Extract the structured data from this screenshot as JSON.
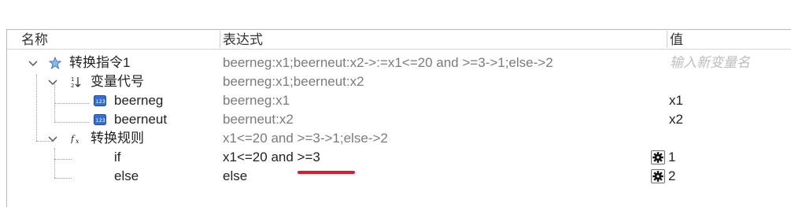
{
  "columns": {
    "name": "名称",
    "expression": "表达式",
    "value": "值"
  },
  "rows": {
    "root": {
      "name": "转换指令1",
      "expr": "beerneg:x1;beerneut:x2->:=x1<=20 and >=3->1;else->2",
      "value_placeholder": "输入新变量名",
      "icon": "star-icon"
    },
    "vars": {
      "name": "变量代号",
      "expr": "beerneg:x1;beerneut:x2",
      "icon": "number-sort-icon"
    },
    "beerneg": {
      "name": "beerneg",
      "expr": "beerneg:x1",
      "value": "x1",
      "icon": "variable-123-icon"
    },
    "beerneut": {
      "name": "beerneut",
      "expr": "beerneut:x2",
      "value": "x2",
      "icon": "variable-123-icon"
    },
    "rules": {
      "name": "转换规则",
      "expr": "x1<=20 and >=3->1;else->2",
      "icon": "function-fx-icon"
    },
    "if": {
      "name": "if",
      "expr": "x1<=20 and >=3",
      "value": "1",
      "icon": "gear-icon"
    },
    "else": {
      "name": "else",
      "expr": "else",
      "value": "2",
      "icon": "gear-icon"
    }
  },
  "annotation": {
    "color": "#d81e2e"
  }
}
